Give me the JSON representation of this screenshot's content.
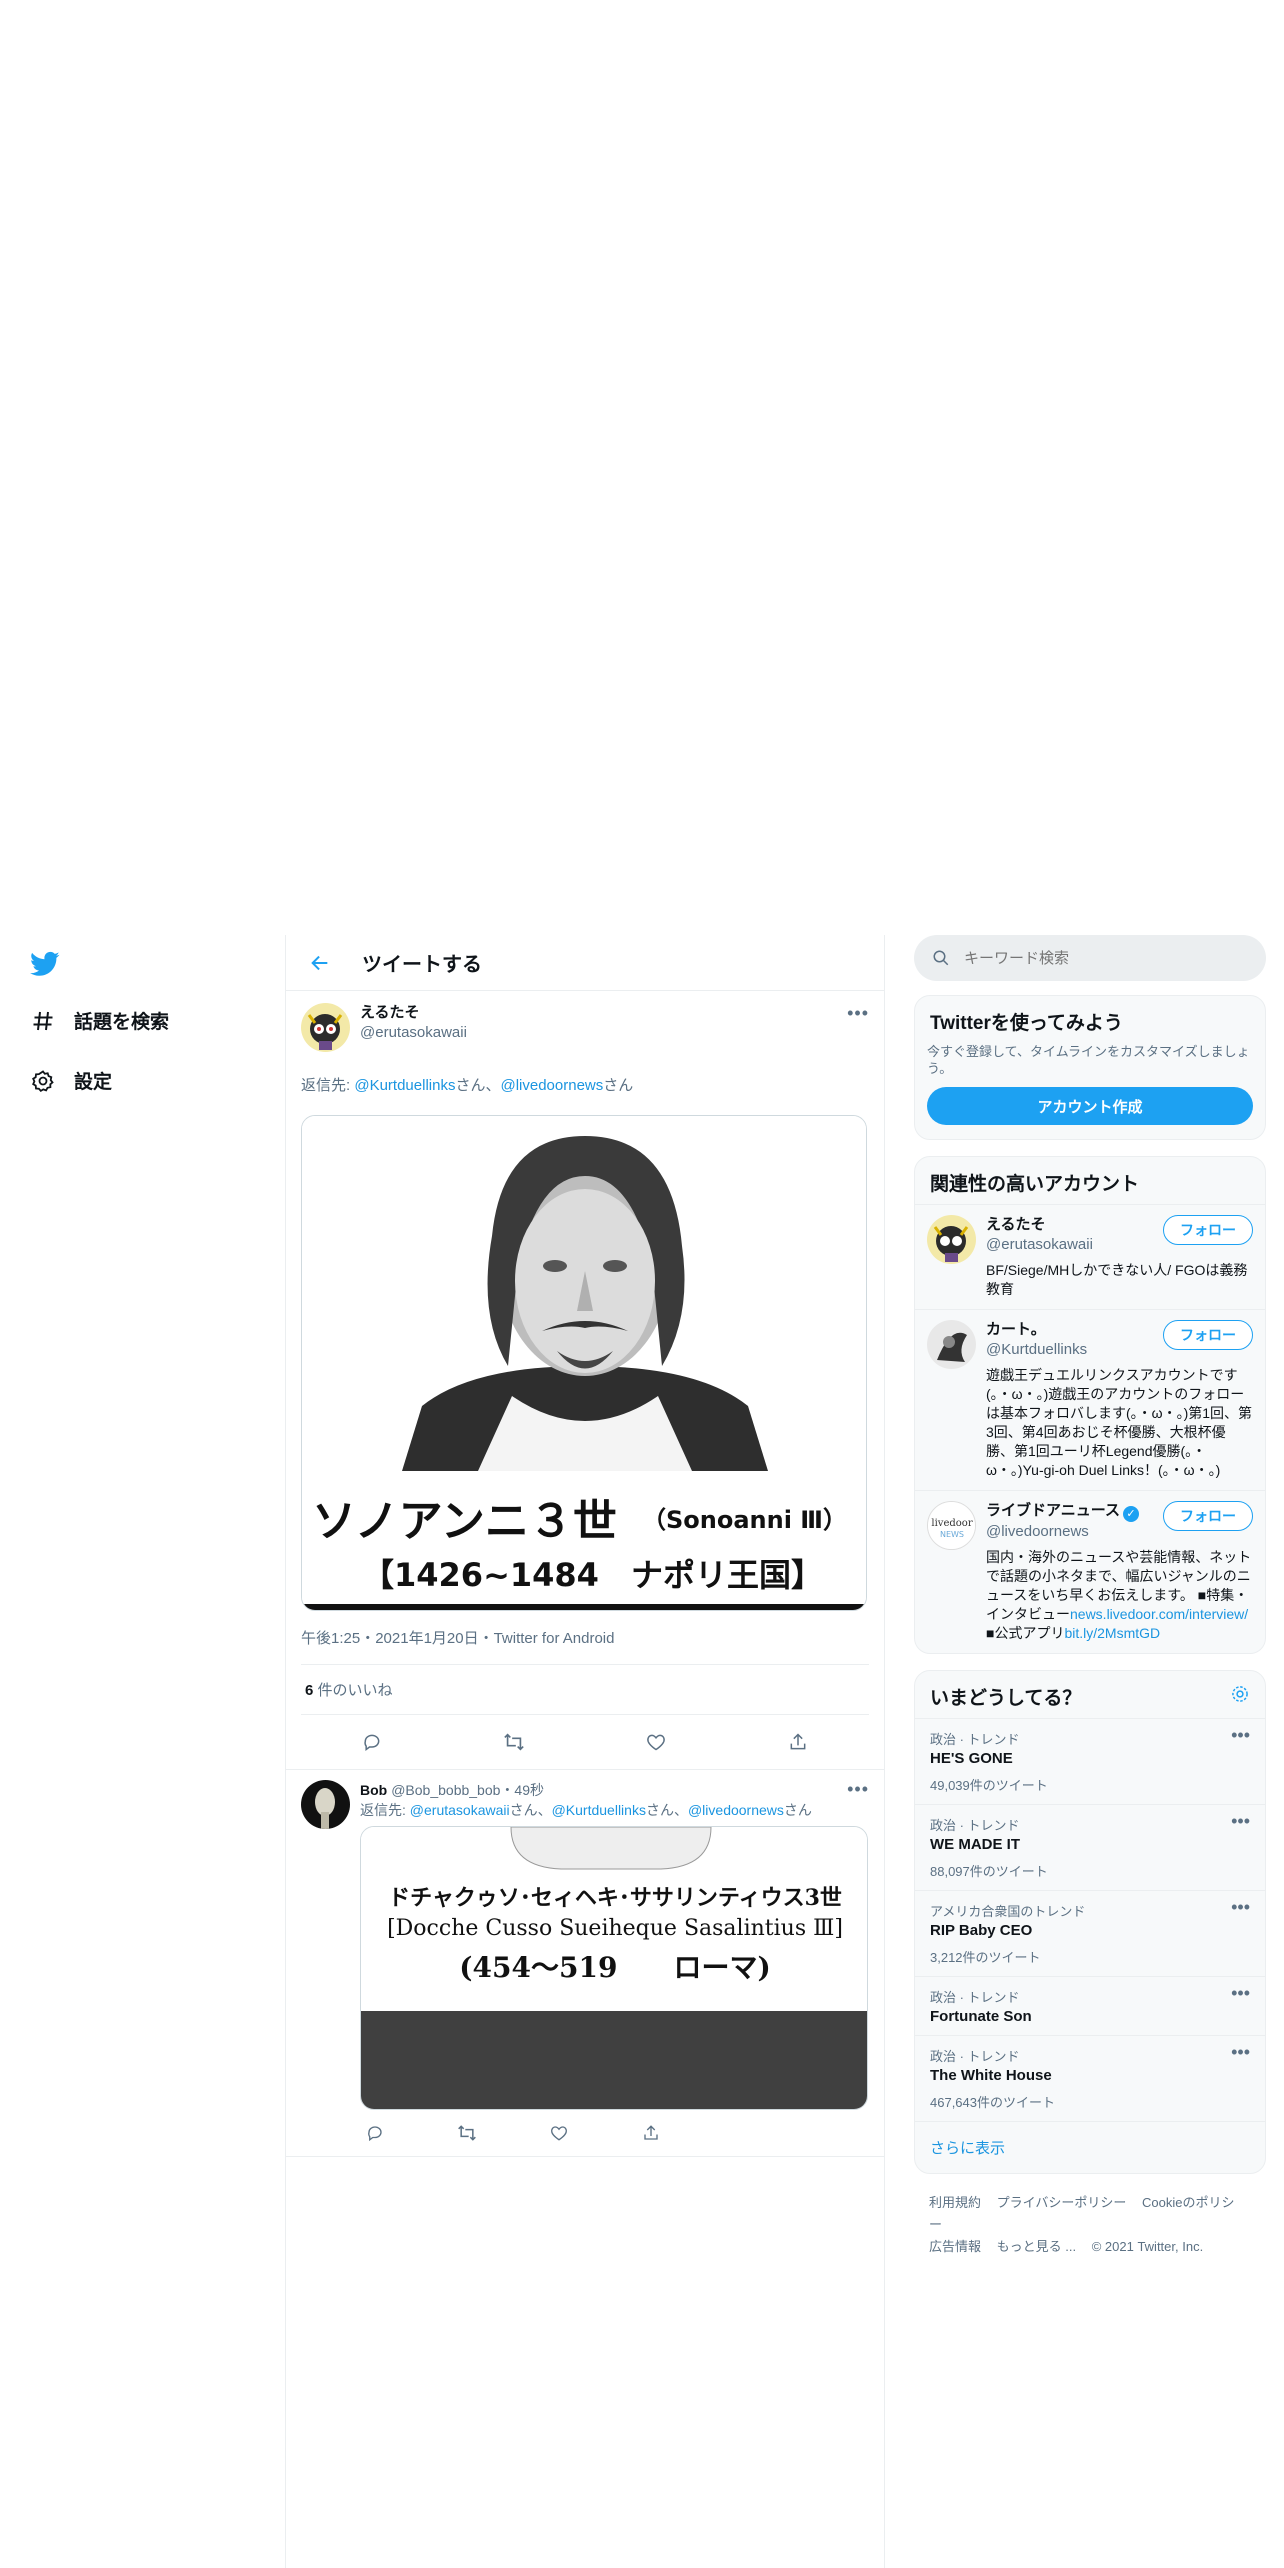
{
  "nav": {
    "explore_label": "話題を検索",
    "settings_label": "設定"
  },
  "header": {
    "title": "ツイートする"
  },
  "main_tweet": {
    "name": "えるたそ",
    "handle": "@erutasokawaii",
    "reply_prefix": "返信先: ",
    "reply_user1": "@Kurtduellinks",
    "reply_san1": "さん、",
    "reply_user2": "@livedoornews",
    "reply_san2": "さん",
    "image_caption_line1": "ソノアンニ３世",
    "image_caption_line1b": "（Sonoanni Ⅲ）",
    "image_caption_line2": "【1426~1484　ナポリ王国】",
    "meta": "午後1:25・2021年1月20日・Twitter for Android",
    "likes_count": "6",
    "likes_label": " 件のいいね"
  },
  "reply_tweet": {
    "name": "Bob",
    "handle": "@Bob_bobb_bob",
    "time": "・49秒",
    "reply_prefix": "返信先: ",
    "reply_user1": "@erutasokawaii",
    "reply_san1": "さん、",
    "reply_user2": "@Kurtduellinks",
    "reply_san2": "さん、",
    "reply_user3": "@livedoornews",
    "reply_san3": "さん",
    "image_line1": "ドチャクゥソ･セィヘキ･ササリンティウス3世",
    "image_line2": "[Docche Cusso Sueiheque Sasalintius Ⅲ]",
    "image_line3": "(454〜519　　ローマ)"
  },
  "search": {
    "placeholder": "キーワード検索"
  },
  "signup": {
    "title": "Twitterを使ってみよう",
    "subtitle": "今すぐ登録して、タイムラインをカスタマイズしましょう。",
    "button": "アカウント作成"
  },
  "related": {
    "title": "関連性の高いアカウント",
    "follow_label": "フォロー",
    "accounts": [
      {
        "name": "えるたそ",
        "handle": "@erutasokawaii",
        "bio": "BF/Siege/MHしかできない人/ FGOは義務教育"
      },
      {
        "name": "カート。",
        "handle": "@Kurtduellinks",
        "bio": "遊戯王デュエルリンクスアカウントです(。・ω・。)遊戯王のアカウントのフォローは基本フォロバします(。・ω・。)第1回、第3回、第4回あおじそ杯優勝、大根杯優勝、第1回ユーリ杯Legend優勝(。・ω・。)Yu-gi-oh Duel Links！(。・ω・。)"
      },
      {
        "name": "ライブドアニュース",
        "handle": "@livedoornews",
        "bio_a": "国内・海外のニュースや芸能情報、ネットで話題の小ネタまで、幅広いジャンルのニュースをいち早くお伝えします。 ■特集・インタビュー",
        "bio_link1": "news.livedoor.com/interview/",
        "bio_b": " ■公式アプリ",
        "bio_link2": "bit.ly/2MsmtGD"
      }
    ]
  },
  "trends": {
    "title": "いまどうしてる？",
    "items": [
      {
        "context": "政治 · トレンド",
        "name": "HE'S GONE",
        "count": "49,039件のツイート"
      },
      {
        "context": "政治 · トレンド",
        "name": "WE MADE IT",
        "count": "88,097件のツイート"
      },
      {
        "context": "アメリカ合衆国のトレンド",
        "name": "RIP Baby CEO",
        "count": "3,212件のツイート"
      },
      {
        "context": "政治 · トレンド",
        "name": "Fortunate Son",
        "count": ""
      },
      {
        "context": "政治 · トレンド",
        "name": "The White House",
        "count": "467,643件のツイート"
      }
    ],
    "show_more": "さらに表示"
  },
  "footer": {
    "links": [
      "利用規約",
      "プライバシーポリシー",
      "Cookieのポリシー",
      "広告情報",
      "もっと見る ..."
    ],
    "copyright": "© 2021 Twitter, Inc."
  },
  "colors": {
    "accent": "#1da1f2",
    "link": "#1b95e0",
    "muted": "#5b7083"
  }
}
